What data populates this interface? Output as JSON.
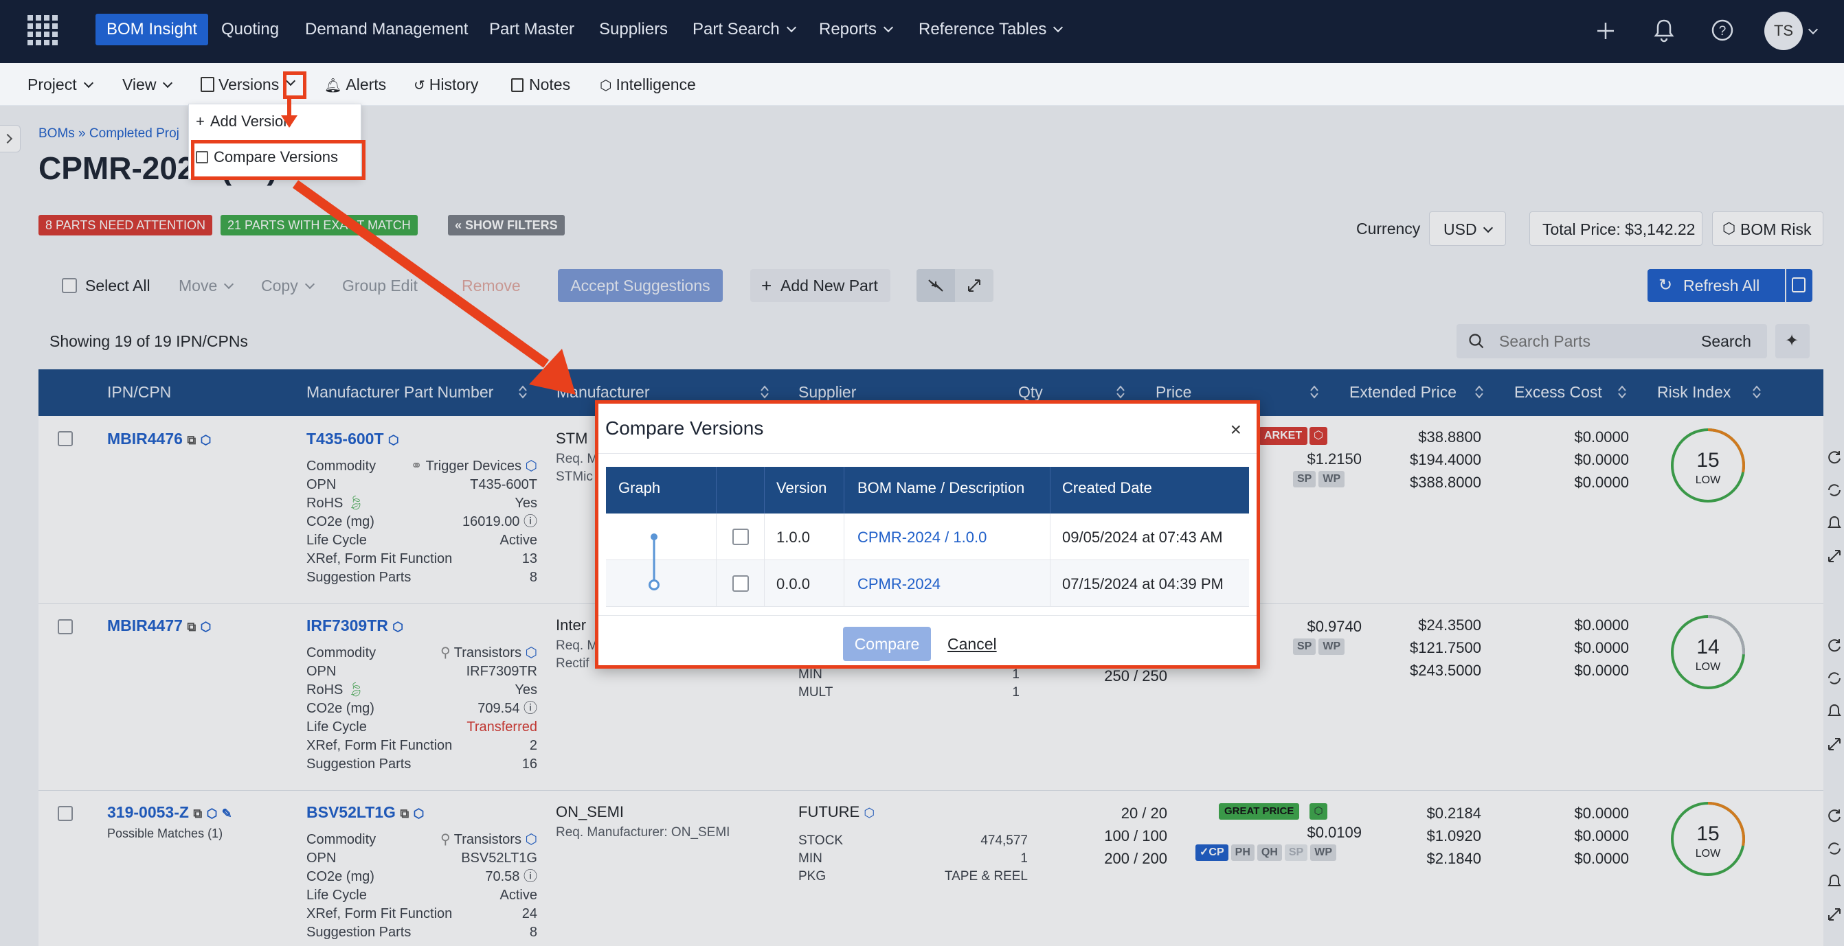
{
  "topnav": {
    "items": [
      "BOM Insight",
      "Quoting",
      "Demand Management",
      "Part Master",
      "Suppliers",
      "Part Search",
      "Reports",
      "Reference Tables"
    ],
    "avatar": "TS"
  },
  "subnav": {
    "items": [
      "Project",
      "View",
      "Versions",
      "Alerts",
      "History",
      "Notes",
      "Intelligence"
    ]
  },
  "dropdown": {
    "add_version": "Add Version",
    "compare_versions": "Compare Versions"
  },
  "page": {
    "breadcrumb": "BOMs » Completed Proj",
    "title": "CPMR-2024 (19)",
    "badge_attention": "8 PARTS NEED ATTENTION",
    "badge_match": "21 PARTS WITH EXACT MATCH",
    "badge_filters": "« SHOW FILTERS",
    "currency_label": "Currency",
    "currency_value": "USD",
    "total_price": "Total Price: $3,142.22",
    "bom_risk": "BOM Risk"
  },
  "toolbar": {
    "select_all": "Select All",
    "move": "Move",
    "copy": "Copy",
    "group_edit": "Group Edit",
    "remove": "Remove",
    "accept": "Accept Suggestions",
    "add_part": "Add New Part",
    "refresh_all": "Refresh All",
    "showing": "Showing 19 of 19 IPN/CPNs",
    "search_placeholder": "Search Parts",
    "search_button": "Search"
  },
  "table": {
    "headers": [
      "IPN/CPN",
      "Manufacturer Part Number",
      "Manufacturer",
      "Supplier",
      "Qty",
      "Price",
      "Extended Price",
      "Excess Cost",
      "Risk Index"
    ],
    "rows": [
      {
        "ipn": "MBIR4476",
        "mpn": "T435-600T",
        "commodity": "Trigger Devices",
        "opn": "T435-600T",
        "rohs": "Yes",
        "co2e": "16019.00",
        "lifecycle": "Active",
        "xref": "13",
        "suggestions": "8",
        "manufacturer": "STM",
        "mfr_sub1": "Req. M",
        "mfr_sub2": "STMic",
        "price_badge": "ARKET",
        "price": "$1.2150",
        "chips": [
          "SP",
          "WP"
        ],
        "ext": [
          "$38.8800",
          "$194.4000",
          "$388.8000"
        ],
        "excess": [
          "$0.0000",
          "$0.0000",
          "$0.0000"
        ],
        "risk": "15",
        "risk_label": "LOW",
        "risk_fraction": 0.28
      },
      {
        "ipn": "MBIR4477",
        "mpn": "IRF7309TR",
        "commodity": "Transistors",
        "opn": "IRF7309TR",
        "rohs": "Yes",
        "co2e": "709.54",
        "lifecycle": "Transferred",
        "xref": "2",
        "suggestions": "16",
        "manufacturer": "Inter",
        "mfr_sub1": "Req. M",
        "mfr_sub2": "Rectif",
        "sup_min": "1",
        "sup_mult": "1",
        "qty_partial": "250 / 250",
        "price": "$0.9740",
        "chips": [
          "SP",
          "WP"
        ],
        "ext": [
          "$24.3500",
          "$121.7500",
          "$243.5000"
        ],
        "excess": [
          "$0.0000",
          "$0.0000",
          "$0.0000"
        ],
        "risk": "14",
        "risk_label": "LOW",
        "risk_fraction": 0.26
      },
      {
        "ipn": "319-0053-Z",
        "possible": "Possible Matches (1)",
        "mpn": "BSV52LT1G",
        "commodity": "Transistors",
        "opn": "BSV52LT1G",
        "co2e": "70.58",
        "lifecycle": "Active",
        "xref": "24",
        "suggestions": "8",
        "manufacturer": "ON_SEMI",
        "mfr_sub1": "Req. Manufacturer: ON_SEMI",
        "supplier": "FUTURE",
        "stock": "474,577",
        "min": "1",
        "pkg": "TAPE & REEL",
        "qty": [
          "20 / 20",
          "100 / 100",
          "200 / 200"
        ],
        "price_badge": "GREAT PRICE",
        "price": "$0.0109",
        "chips": [
          "✓CP",
          "PH",
          "QH",
          "SP",
          "WP"
        ],
        "ext": [
          "$0.2184",
          "$1.0920",
          "$2.1840"
        ],
        "excess": [
          "$0.0000",
          "$0.0000",
          "$0.0000"
        ],
        "risk": "15",
        "risk_label": "LOW",
        "risk_fraction": 0.28
      }
    ],
    "labels": {
      "commodity": "Commodity",
      "opn": "OPN",
      "rohs": "RoHS",
      "co2e": "CO2e (mg)",
      "lifecycle": "Life Cycle",
      "xref": "XRef, Form Fit Function",
      "suggestions": "Suggestion Parts",
      "stock": "STOCK",
      "min": "MIN",
      "mult": "MULT",
      "pkg": "PKG"
    }
  },
  "modal": {
    "title": "Compare Versions",
    "headers": [
      "Graph",
      "",
      "Version",
      "BOM Name / Description",
      "Created Date"
    ],
    "rows": [
      {
        "version": "1.0.0",
        "name": "CPMR-2024 / 1.0.0",
        "date": "09/05/2024 at 07:43 AM"
      },
      {
        "version": "0.0.0",
        "name": "CPMR-2024",
        "date": "07/15/2024 at 04:39 PM"
      }
    ],
    "compare": "Compare",
    "cancel": "Cancel"
  },
  "colors": {
    "nav_bg": "#141f36",
    "accent": "#1f5fc9",
    "header_bg": "#1d4a83",
    "annotation": "#e8401c",
    "success": "#3ea84a",
    "danger": "#d73a31"
  }
}
